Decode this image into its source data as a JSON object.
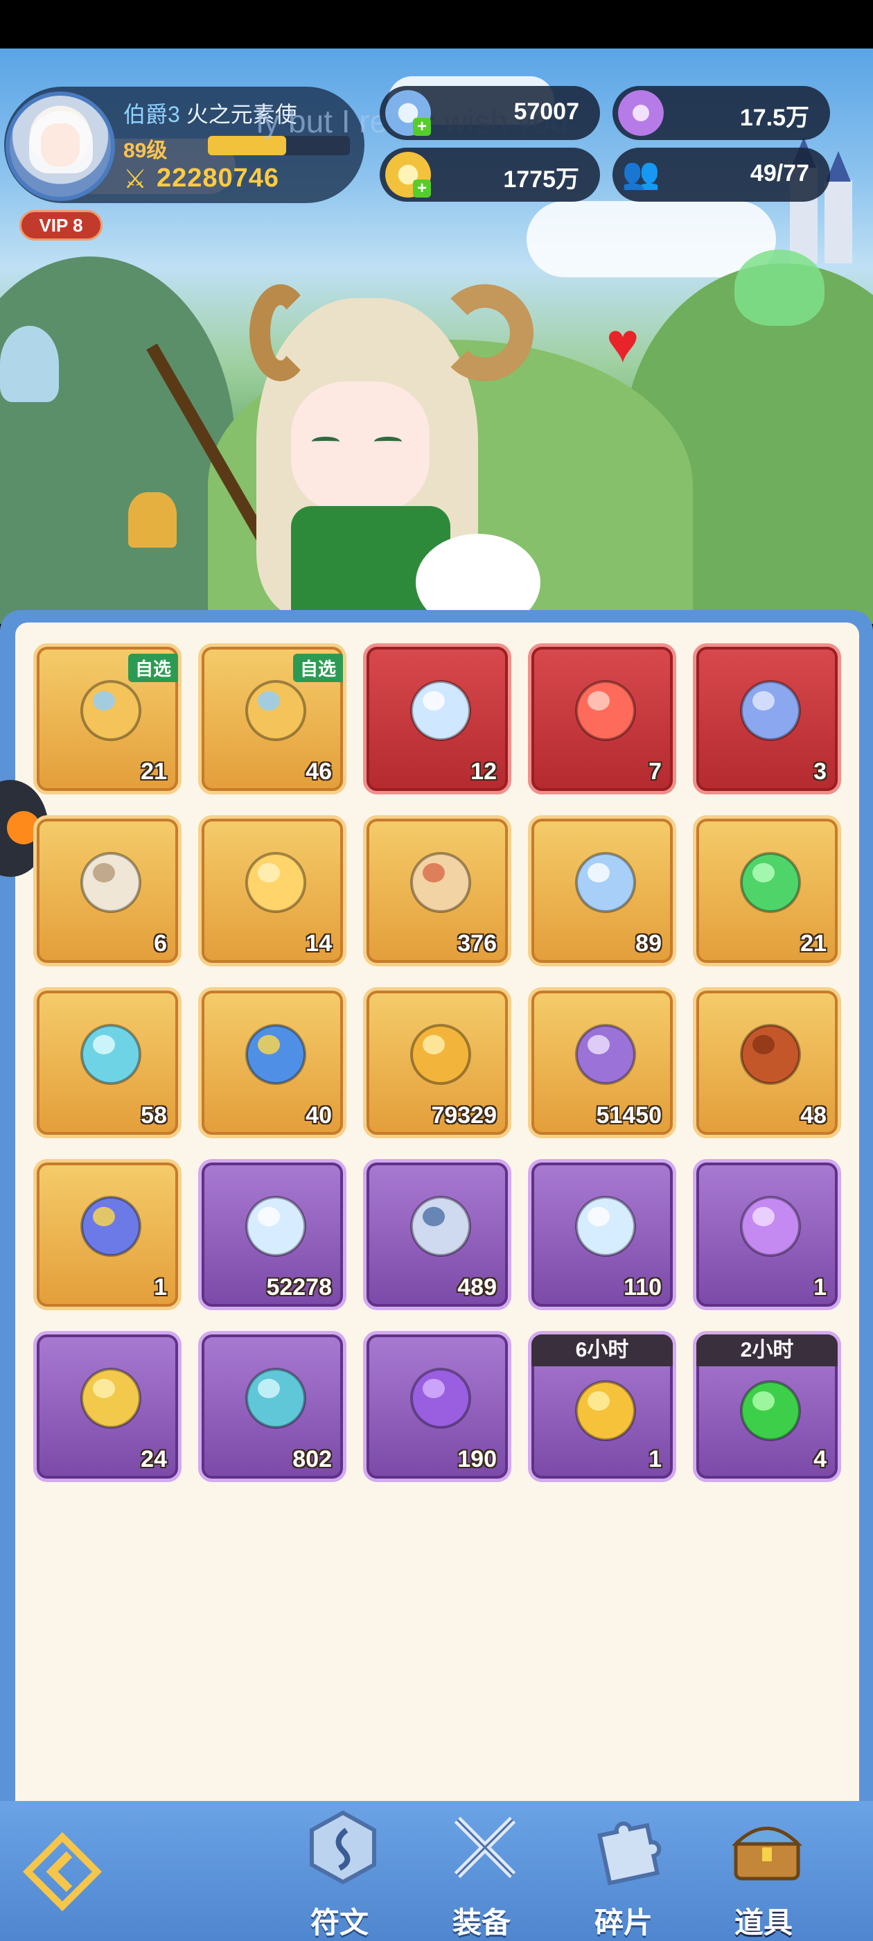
{
  "player": {
    "rank": "伯爵3",
    "name": "火之元素使",
    "level": "89级",
    "exp_progress": 0.55,
    "power": "22280746",
    "vip": "VIP 8",
    "subtitle": "ly but I really wish you"
  },
  "resources": [
    {
      "name": "diamond",
      "icon": "star-gem-icon",
      "value": "57007",
      "has_plus": true
    },
    {
      "name": "purple-coin",
      "icon": "purple-coin-icon",
      "value": "17.5万",
      "has_plus": false
    },
    {
      "name": "gold",
      "icon": "gold-coin-icon",
      "value": "1775万",
      "has_plus": true
    },
    {
      "name": "members",
      "icon": "people-icon",
      "value": "49/77",
      "has_plus": false
    }
  ],
  "inventory": [
    {
      "icon": "gift-box-choice-icon",
      "count": "21",
      "rarity": "gold",
      "tag": "自选"
    },
    {
      "icon": "gift-box-choice-icon",
      "count": "46",
      "rarity": "gold",
      "tag": "自选"
    },
    {
      "icon": "crystal-flower-icon",
      "count": "12",
      "rarity": "red"
    },
    {
      "icon": "red-rune-crystal-icon",
      "count": "7",
      "rarity": "red"
    },
    {
      "icon": "blue-ticket-icon",
      "count": "3",
      "rarity": "red"
    },
    {
      "icon": "coral-icon",
      "count": "6",
      "rarity": "gold"
    },
    {
      "icon": "gold-rune-crystal-icon",
      "count": "14",
      "rarity": "gold"
    },
    {
      "icon": "gold-ticket-icon",
      "count": "376",
      "rarity": "gold"
    },
    {
      "icon": "blue-star-crystal-icon",
      "count": "89",
      "rarity": "gold"
    },
    {
      "icon": "green-crystal-icon",
      "count": "21",
      "rarity": "gold"
    },
    {
      "icon": "heart-card-icon",
      "count": "58",
      "rarity": "gold"
    },
    {
      "icon": "lightning-potion-icon",
      "count": "40",
      "rarity": "gold"
    },
    {
      "icon": "gold-medal-icon",
      "count": "79329",
      "rarity": "gold"
    },
    {
      "icon": "purple-medal-icon",
      "count": "51450",
      "rarity": "gold"
    },
    {
      "icon": "dragon-egg-icon",
      "count": "48",
      "rarity": "gold"
    },
    {
      "icon": "swap-potion-icon",
      "count": "1",
      "rarity": "gold"
    },
    {
      "icon": "diamond-shard-icon",
      "count": "52278",
      "rarity": "purple"
    },
    {
      "icon": "hourglass-icon",
      "count": "489",
      "rarity": "purple"
    },
    {
      "icon": "ice-crystal-icon",
      "count": "110",
      "rarity": "purple"
    },
    {
      "icon": "purple-rune-crystal-icon",
      "count": "1",
      "rarity": "purple"
    },
    {
      "icon": "gold-card-icon",
      "count": "24",
      "rarity": "purple"
    },
    {
      "icon": "orb-icon",
      "count": "802",
      "rarity": "purple"
    },
    {
      "icon": "purple-egg-icon",
      "count": "190",
      "rarity": "purple"
    },
    {
      "icon": "gold-coins-stack-icon",
      "count": "1",
      "rarity": "purple",
      "time": "6小时"
    },
    {
      "icon": "green-potion-icon",
      "count": "4",
      "rarity": "purple",
      "time": "2小时"
    }
  ],
  "nav": {
    "tabs": [
      {
        "label": "符文",
        "icon": "rune-icon",
        "active": false
      },
      {
        "label": "装备",
        "icon": "crossed-swords-icon",
        "active": false
      },
      {
        "label": "碎片",
        "icon": "puzzle-piece-icon",
        "active": false
      },
      {
        "label": "道具",
        "icon": "treasure-chest-icon",
        "active": true
      }
    ]
  },
  "colors": {
    "gold_slot": "#e39e3a",
    "red_slot": "#b42a2f",
    "purple_slot": "#7b4aa8",
    "panel_border": "#5b93d8",
    "panel_bg": "#fcf6ea"
  }
}
